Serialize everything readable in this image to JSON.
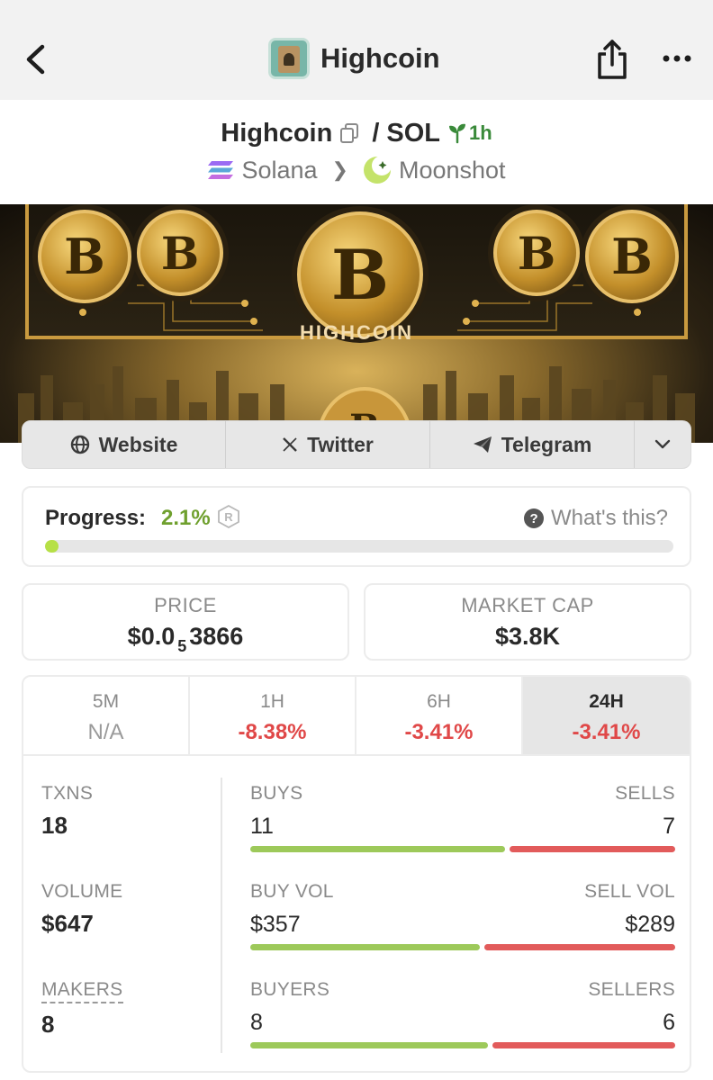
{
  "nav": {
    "title": "Highcoin",
    "back_icon": "chevron-left-icon",
    "share_icon": "share-icon",
    "more_icon": "ellipsis-icon"
  },
  "pair": {
    "base": "Highcoin",
    "separator": "/",
    "quote": "SOL",
    "age": "1h",
    "chain": "Solana",
    "dex": "Moonshot"
  },
  "banner": {
    "text": "HIGHCOIN"
  },
  "social": {
    "website": "Website",
    "twitter": "Twitter",
    "telegram": "Telegram"
  },
  "progress": {
    "label": "Progress:",
    "value": "2.1%",
    "fraction": 0.021,
    "help": "What's this?"
  },
  "price": {
    "label": "PRICE",
    "prefix": "$0.0",
    "zeros": "5",
    "digits": "3866"
  },
  "market_cap": {
    "label": "MARKET CAP",
    "value": "$3.8K"
  },
  "timeframes": [
    {
      "label": "5M",
      "value": "N/A"
    },
    {
      "label": "1H",
      "value": "-8.38%"
    },
    {
      "label": "6H",
      "value": "-3.41%"
    },
    {
      "label": "24H",
      "value": "-3.41%",
      "active": true
    }
  ],
  "stats": {
    "txns": {
      "label": "TXNS",
      "value": "18"
    },
    "volume": {
      "label": "VOLUME",
      "value": "$647"
    },
    "makers": {
      "label": "MAKERS",
      "value": "8"
    },
    "buys_sells": {
      "left_label": "BUYS",
      "right_label": "SELLS",
      "left": "11",
      "right": "7",
      "left_share": 0.61
    },
    "vol_split": {
      "left_label": "BUY VOL",
      "right_label": "SELL VOL",
      "left": "$357",
      "right": "$289",
      "left_share": 0.55
    },
    "buyers_sellers": {
      "left_label": "BUYERS",
      "right_label": "SELLERS",
      "left": "8",
      "right": "6",
      "left_share": 0.57
    }
  },
  "colors": {
    "positive": "#9dc95a",
    "negative": "#e25b5b",
    "progress": "#b6e046",
    "age": "#3a8a3a"
  }
}
